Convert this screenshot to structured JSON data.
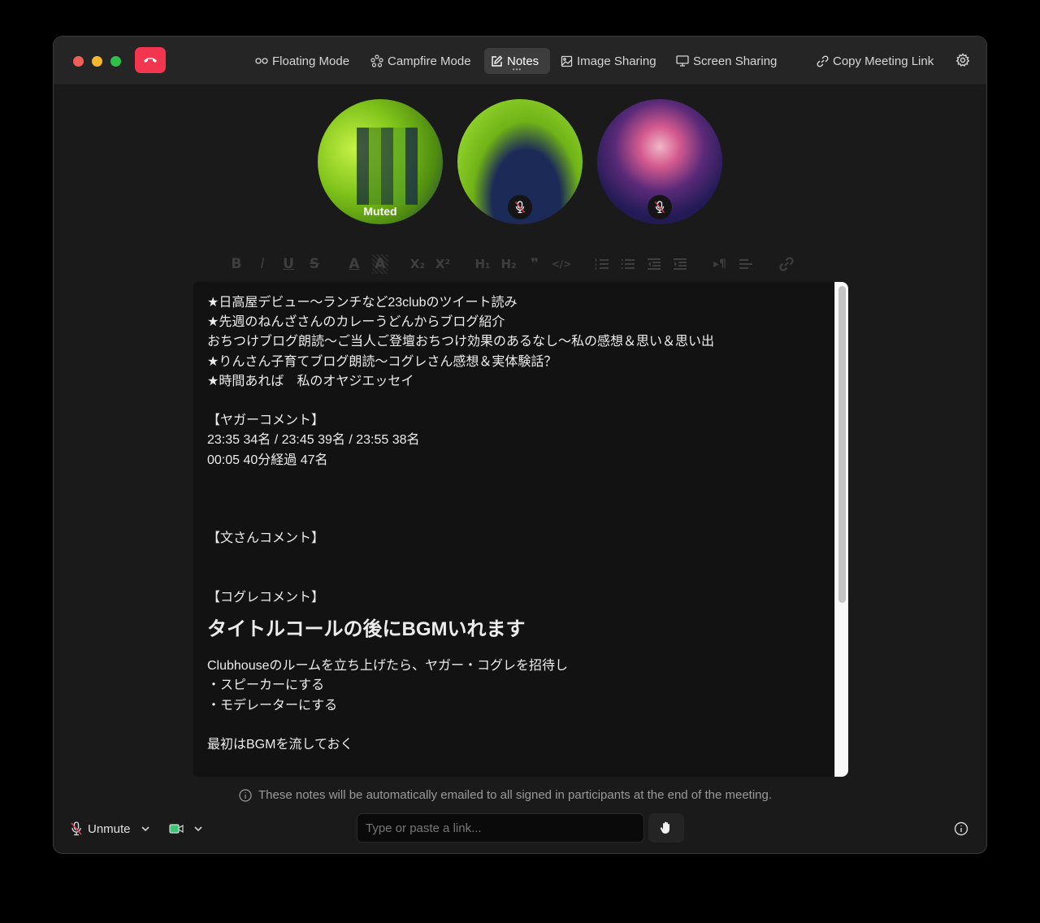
{
  "window": {
    "traffic_lights": [
      "close",
      "minimize",
      "zoom"
    ],
    "hangup_icon": "phone-hangup-icon",
    "colors": {
      "hangup": "#f3364f",
      "active_tab": "#3d3d3d",
      "camera": "#3dc476",
      "mute_slash": "#e0405a"
    }
  },
  "nav": {
    "items": [
      {
        "label": "Floating Mode",
        "icon": "floating-mode-icon",
        "active": false
      },
      {
        "label": "Campfire Mode",
        "icon": "campfire-icon",
        "active": false
      },
      {
        "label": "Notes",
        "icon": "notes-edit-icon",
        "active": true,
        "more": "•••"
      },
      {
        "label": "Image Sharing",
        "icon": "image-icon",
        "active": false
      },
      {
        "label": "Screen Sharing",
        "icon": "monitor-icon",
        "active": false
      },
      {
        "label": "Copy Meeting Link",
        "icon": "link-icon",
        "active": false
      }
    ],
    "settings_icon": "gear-icon"
  },
  "participants": [
    {
      "label": "Muted",
      "video": "pixelated",
      "muted": true
    },
    {
      "label": "",
      "video": "camera",
      "muted": true
    },
    {
      "label": "",
      "video": "camera",
      "muted": true
    }
  ],
  "toolbar": {
    "buttons": [
      "bold",
      "italic",
      "underline",
      "strikethrough",
      "text-color",
      "highlight",
      "subscript",
      "superscript",
      "heading-1",
      "heading-2",
      "blockquote",
      "code",
      "ordered-list",
      "bullet-list",
      "outdent",
      "indent",
      "text-direction",
      "align",
      "link"
    ],
    "glyphs": {
      "bold": "B",
      "italic": "I",
      "underline": "U",
      "strike": "S",
      "color": "A",
      "highlight": "A",
      "sub": "X₂",
      "sup": "X²",
      "h1": "H₁",
      "h2": "H₂",
      "quote": "❞",
      "code": "</>",
      "dir": "▸¶"
    }
  },
  "notes": {
    "lines": [
      "★日高屋デビュー〜ランチなど23clubのツイート読み",
      "★先週のねんざさんのカレーうどんからブログ紹介",
      "おちつけブログ朗読〜ご当人ご登壇おちつけ効果のあるなし〜私の感想＆思い＆思い出",
      "★りんさん子育てブログ朗読〜コグレさん感想＆実体験話？",
      "★時間あれば　私のオヤジエッセイ",
      "",
      "【ヤガーコメント】",
      "23:35 34名 / 23:45 39名 / 23:55 38名",
      "00:05 40分経過 47名",
      "",
      "",
      "",
      "【文さんコメント】",
      "",
      "",
      "【コグレコメント】"
    ],
    "heading": "タイトルコールの後にBGMいれます",
    "lines_after": [
      "Clubhouseのルームを立ち上げたら、ヤガー・コグレを招待し",
      "・スピーカーにする",
      "・モデレーターにする",
      "",
      "最初はBGMを流しておく"
    ]
  },
  "notice": "These notes will be automatically emailed to all signed in participants at the end of the meeting.",
  "bottom": {
    "unmute_label": "Unmute",
    "link_placeholder": "Type or paste a link...",
    "link_value": "",
    "raise_hand_icon": "hand-icon",
    "info_icon": "info-icon"
  }
}
